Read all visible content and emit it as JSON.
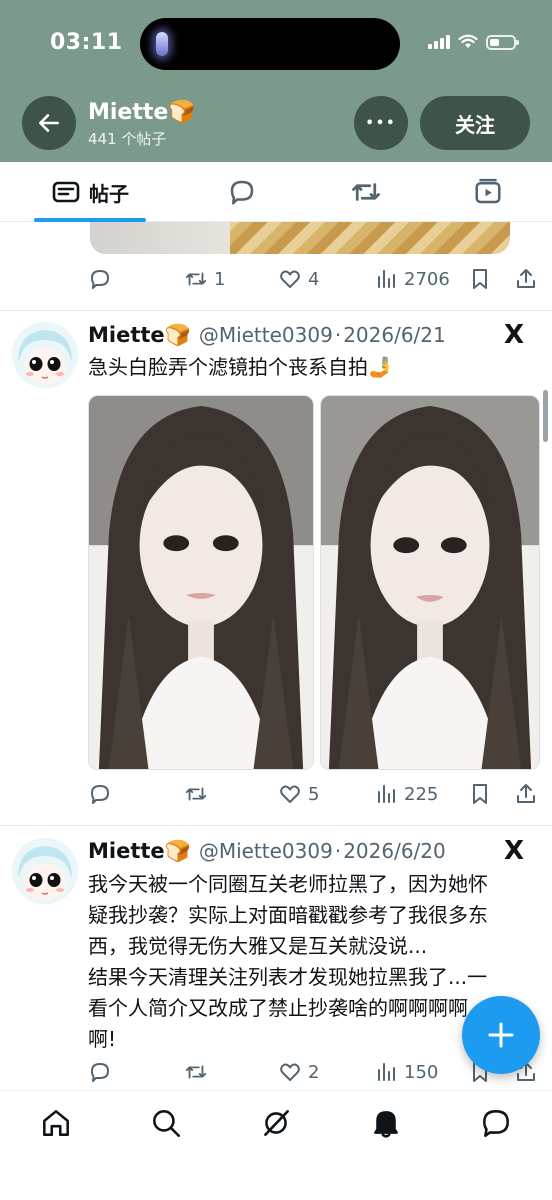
{
  "status_bar": {
    "time": "03:11"
  },
  "header": {
    "profile_name": "Miette🍞",
    "post_count": "441 个帖子",
    "follow_label": "关注",
    "more_label": "•••"
  },
  "tabs": {
    "posts_label": "帖子",
    "icons": [
      "posts-icon",
      "replies-icon",
      "repost-icon",
      "media-icon"
    ]
  },
  "prev_post": {
    "stats": {
      "replies": "",
      "reposts": "1",
      "likes": "4",
      "views": "2706"
    }
  },
  "posts": [
    {
      "name": "Miette🍞",
      "handle": "@Miette0309",
      "separator": "·",
      "date": "2026/6/21",
      "text": "急头白脸弄个滤镜拍个丧系自拍🤳",
      "stats": {
        "replies": "",
        "reposts": "",
        "likes": "5",
        "views": "225"
      }
    },
    {
      "name": "Miette🍞",
      "handle": "@Miette0309",
      "separator": "·",
      "date": "2026/6/20",
      "text_lines": [
        "我今天被一个同圈互关老师拉黑了，因为她怀",
        "疑我抄袭？实际上对面暗戳戳参考了我很多东",
        "西，我觉得无伤大雅又是互关就没说...",
        "结果今天清理关注列表才发现她拉黑我了...一",
        "看个人简介又改成了禁止抄袭啥的啊啊啊啊",
        "啊!"
      ],
      "stats": {
        "replies": "",
        "reposts": "",
        "likes": "2",
        "views": "150"
      }
    }
  ],
  "x_logo": "𝕏",
  "fab": {
    "icon": "plus-icon"
  },
  "bottom_nav": [
    "home-icon",
    "search-icon",
    "grok-icon",
    "notifications-icon",
    "messages-icon"
  ],
  "colors": {
    "header_bg": "#7b9a8c",
    "button_bg": "#3f5448",
    "accent": "#1d9bf0",
    "muted": "#536471"
  }
}
